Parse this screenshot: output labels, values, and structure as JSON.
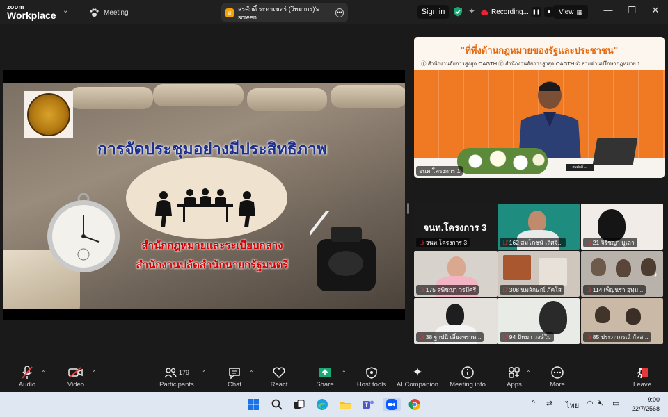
{
  "app": {
    "brand_top": "zoom",
    "brand_bottom": "Workplace"
  },
  "tabs": {
    "meeting": "Meeting",
    "share": "สรศักดิ์ ระดาเขตร์ (วิทยากร)'s screen",
    "share_badge": "ส"
  },
  "header": {
    "signin": "Sign in",
    "recording": "Recording...",
    "view": "View"
  },
  "slide": {
    "title": "การจัดประชุมอย่างมีประสิทธิภาพ",
    "line1": "สำนักกฎหมายและระเบียบกลาง",
    "line2": "สำนักงานปลัดสำนักนายกรัฐมนตรี"
  },
  "speaker": {
    "banner": "\"ที่พึ่งด้านกฎหมายของรัฐและประชาชน\"",
    "banner_sub": "ⓕ สำนักงานอัยการสูงสุด OAGTH   ⓕ สำนักงานอัยการสูงสุด OAGTH   ✆ สายด่วนปรึกษากฎหมาย 1",
    "nameplate": "สมศักดิ์ ...",
    "label": "จนท.โครงการ 1"
  },
  "gallery": {
    "feature_title": "จนท.โครงการ 3",
    "tiles": [
      {
        "label": "จนท.โครงการ 3"
      },
      {
        "label": "162 สมโภชน์ เลิศจิ..."
      },
      {
        "label": "21 จิรัชญา มูเลา"
      },
      {
        "label": "175 สุพิชญา วรมีศรี"
      },
      {
        "label": "308 นพลักษณ์ ภัคโส"
      },
      {
        "label": "114 เพ็ญนรา อุทุม..."
      },
      {
        "label": "38 ฐาปนี เลี้ยงพราห..."
      },
      {
        "label": "94 ปัทมา วงษ์ใม"
      },
      {
        "label": "85 ประภาภรณ์ กัลส..."
      }
    ]
  },
  "toolbar": {
    "audio": "Audio",
    "video": "Video",
    "participants": "Participants",
    "participants_count": "179",
    "chat": "Chat",
    "react": "React",
    "share": "Share",
    "host_tools": "Host tools",
    "ai": "AI Companion",
    "info": "Meeting info",
    "apps": "Apps",
    "more": "More",
    "leave": "Leave"
  },
  "taskbar": {
    "lang": "ไทย",
    "time": "9:00",
    "date": "22/7/2568"
  },
  "colors": {
    "accent_green": "#19a974",
    "leave_red": "#e5383b",
    "speaker_orange": "#f07a24",
    "slide_title_blue": "#1d2f8f",
    "slide_sub_red": "#d60000"
  }
}
